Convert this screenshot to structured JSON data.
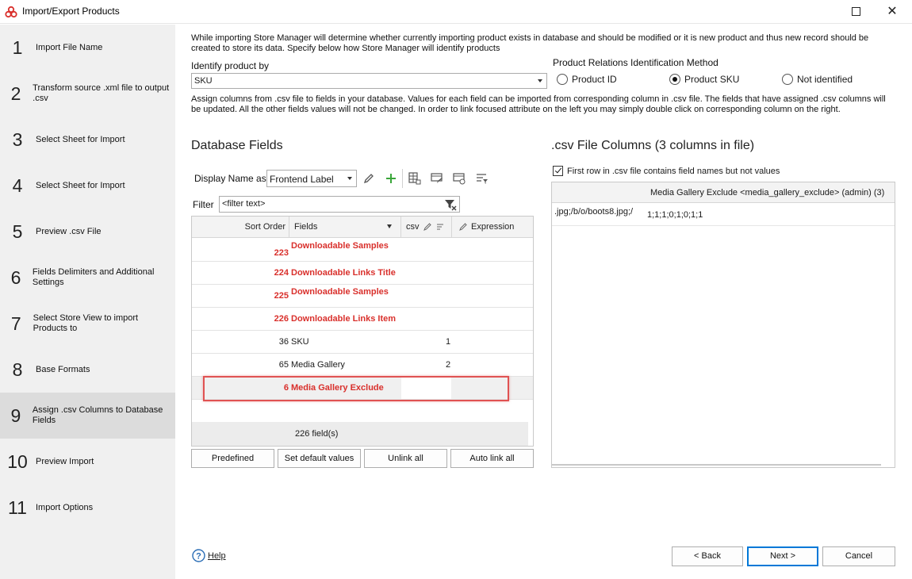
{
  "window": {
    "title": "Import/Export Products"
  },
  "steps": [
    {
      "num": "1",
      "label": "Import File Name"
    },
    {
      "num": "2",
      "label": "Transform source .xml file to output .csv"
    },
    {
      "num": "3",
      "label": "Select Sheet for Import"
    },
    {
      "num": "4",
      "label": "Select Sheet for Import"
    },
    {
      "num": "5",
      "label": "Preview .csv File"
    },
    {
      "num": "6",
      "label": "Fields Delimiters and Additional Settings"
    },
    {
      "num": "7",
      "label": "Select Store View to import Products to"
    },
    {
      "num": "8",
      "label": "Base Formats"
    },
    {
      "num": "9",
      "label": "Assign .csv Columns to Database Fields"
    },
    {
      "num": "10",
      "label": "Preview Import"
    },
    {
      "num": "11",
      "label": "Import Options"
    }
  ],
  "intro": {
    "text": "While importing Store Manager will determine whether currently importing product exists in database and should be modified or it is new product and thus new record should be created to store its data. Specify below how Store Manager will identify products"
  },
  "identify": {
    "label": "Identify product by",
    "value": "SKU"
  },
  "relations": {
    "title": "Product Relations Identification Method",
    "options": [
      "Product ID",
      "Product SKU",
      "Not identified"
    ],
    "selected": "Product SKU"
  },
  "assign_text": "Assign columns from .csv file to fields in your database. Values for each field can be imported from corresponding column in .csv file. The fields that have assigned .csv columns will be updated. All the other fields values will not be changed. In order to link focused attribute on the left you may simply double click on corresponding column on the right.",
  "db_fields": {
    "title": "Database Fields",
    "display_name_label": "Display Name as",
    "display_name_value": "Frontend Label",
    "filter_label": "Filter",
    "filter_value": "<filter text>",
    "columns": {
      "sort_order": "Sort Order",
      "fields": "Fields",
      "csv": "csv",
      "expression": "Expression"
    },
    "rows": [
      {
        "order": "223",
        "field": "Downloadable Samples",
        "csv": "",
        "required": true
      },
      {
        "order": "224",
        "field": "Downloadable Links Title",
        "csv": "",
        "required": true
      },
      {
        "order": "225",
        "field": "Downloadable Samples",
        "csv": "",
        "required": true
      },
      {
        "order": "226",
        "field": "Downloadable Links Item",
        "csv": "",
        "required": true
      },
      {
        "order": "36",
        "field": "SKU",
        "csv": "1",
        "required": false
      },
      {
        "order": "65",
        "field": "Media Gallery",
        "csv": "2",
        "required": false
      },
      {
        "order": "6",
        "field": "Media Gallery Exclude",
        "csv": "",
        "required": true
      }
    ],
    "footer": "226 field(s)",
    "buttons": {
      "predefined": "Predefined",
      "set_default": "Set default values",
      "unlink_all": "Unlink all",
      "auto_link": "Auto link all"
    }
  },
  "csv_columns": {
    "title": ".csv File Columns (3 columns in file)",
    "first_row_label": "First row in .csv file contains field names but not values",
    "first_row_checked": true,
    "header": "Media Gallery Exclude <media_gallery_exclude> (admin) (3)",
    "row_left": ".jpg;/b/o/boots8.jpg;/",
    "row_right": "1;1;1;0;1;0;1;1"
  },
  "footer_nav": {
    "help": "Help",
    "back": "< Back",
    "next": "Next >",
    "cancel": "Cancel"
  },
  "colors": {
    "required_field": "#d9302c",
    "highlight_box": "#e05252",
    "sidebar_bg": "#f0f0f0",
    "active_step_bg": "#dcdcdc"
  }
}
